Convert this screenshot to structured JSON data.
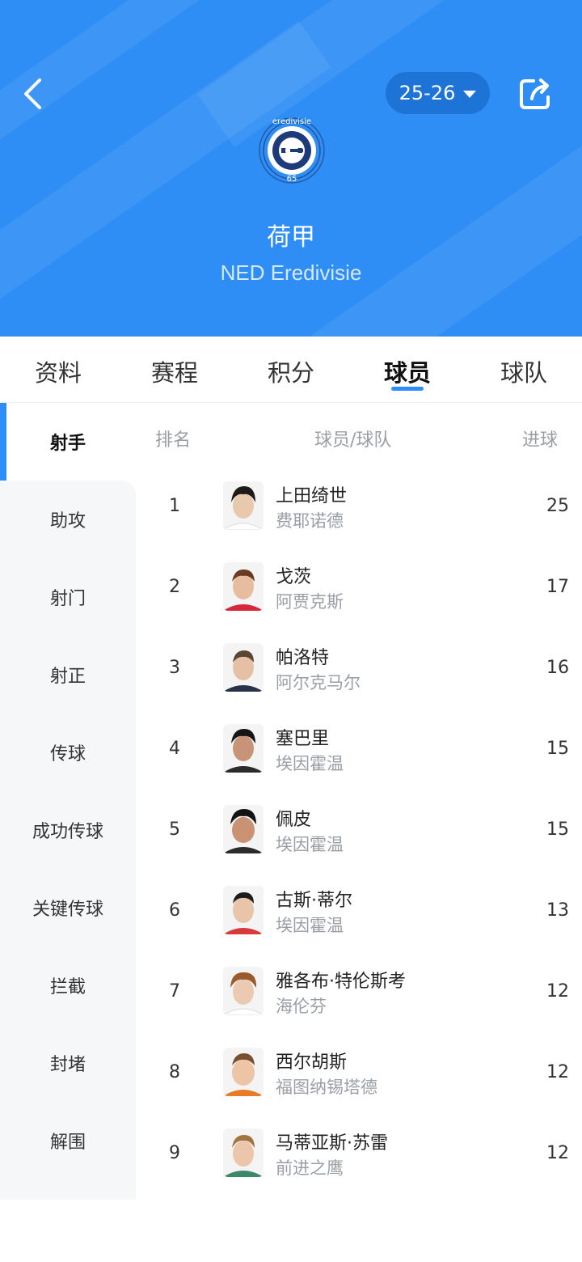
{
  "header": {
    "season": "25-26",
    "league_name": "荷甲",
    "league_en": "NED Eredivisie",
    "logo_text": "eredivisie",
    "logo_number": "65",
    "bg_color": "#2f8ef5"
  },
  "tabs": [
    {
      "label": "资料"
    },
    {
      "label": "赛程"
    },
    {
      "label": "积分"
    },
    {
      "label": "球员",
      "active": true
    },
    {
      "label": "球队"
    }
  ],
  "sidebar": {
    "items": [
      {
        "label": "射手",
        "active": true
      },
      {
        "label": "助攻"
      },
      {
        "label": "射门"
      },
      {
        "label": "射正"
      },
      {
        "label": "传球"
      },
      {
        "label": "成功传球"
      },
      {
        "label": "关键传球"
      },
      {
        "label": "拦截"
      },
      {
        "label": "封堵"
      },
      {
        "label": "解围"
      }
    ]
  },
  "table": {
    "headers": {
      "rank": "排名",
      "player": "球员/球队",
      "stat": "进球"
    },
    "rows": [
      {
        "rank": "1",
        "name": "上田绮世",
        "team": "费耶诺德",
        "goals": "25"
      },
      {
        "rank": "2",
        "name": "戈茨",
        "team": "阿贾克斯",
        "goals": "17"
      },
      {
        "rank": "3",
        "name": "帕洛特",
        "team": "阿尔克马尔",
        "goals": "16"
      },
      {
        "rank": "4",
        "name": "塞巴里",
        "team": "埃因霍温",
        "goals": "15"
      },
      {
        "rank": "5",
        "name": "佩皮",
        "team": "埃因霍温",
        "goals": "15"
      },
      {
        "rank": "6",
        "name": "古斯·蒂尔",
        "team": "埃因霍温",
        "goals": "13"
      },
      {
        "rank": "7",
        "name": "雅各布·特伦斯考",
        "team": "海伦芬",
        "goals": "12"
      },
      {
        "rank": "8",
        "name": "西尔胡斯",
        "team": "福图纳锡塔德",
        "goals": "12"
      },
      {
        "rank": "9",
        "name": "马蒂亚斯·苏雷",
        "team": "前进之鹰",
        "goals": "12"
      }
    ]
  }
}
